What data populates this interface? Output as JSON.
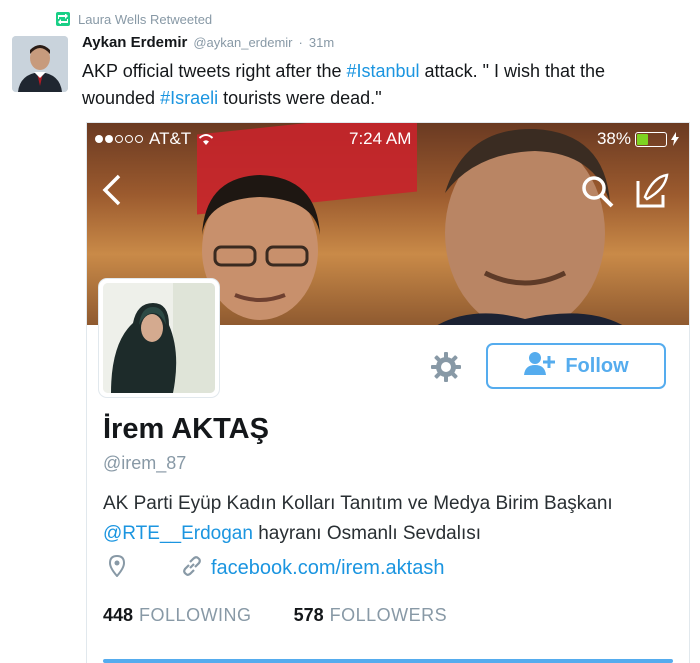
{
  "retweet": {
    "label": "Laura Wells Retweeted"
  },
  "tweet": {
    "author_name": "Aykan Erdemir",
    "author_handle": "@aykan_erdemir",
    "separator": "·",
    "time": "31m",
    "text_part1": "AKP official tweets right after the ",
    "hashtag1": "#Istanbul",
    "text_part2": " attack. \" I wish that the wounded ",
    "hashtag2": "#Israeli",
    "text_part3": " tourists were dead.\""
  },
  "phone_status": {
    "carrier": "AT&T",
    "time": "7:24 AM",
    "battery": "38%",
    "battery_level": 0.38
  },
  "profile": {
    "name": "İrem AKTAŞ",
    "handle": "@irem_87",
    "bio_part1": "AK Parti Eyüp Kadın Kolları Tanıtım ve Medya Birim Başkanı ",
    "bio_mention": "@RTE__Erdogan",
    "bio_part2": " hayranı Osmanlı Sevdalısı",
    "link": "facebook.com/irem.aktash",
    "follow_label": "Follow",
    "following_count": "448",
    "following_label": "FOLLOWING",
    "followers_count": "578",
    "followers_label": "FOLLOWERS"
  },
  "icons": {
    "retweet": "retweet-icon",
    "back": "chevron-left-icon",
    "search": "search-icon",
    "compose": "compose-icon",
    "gear": "gear-icon",
    "follow": "add-person-icon",
    "location": "location-pin-icon",
    "link": "link-icon"
  },
  "colors": {
    "twitter_blue": "#55acee",
    "link_blue": "#1b95e0",
    "retweet_green": "#19cf86",
    "muted_gray": "#8899a6"
  }
}
